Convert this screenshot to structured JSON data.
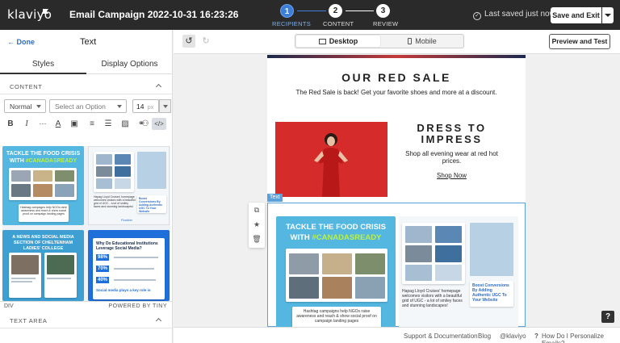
{
  "topbar": {
    "logo": "klaviyo",
    "campaign_title": "Email Campaign 2022-10-31 16:23:26",
    "steps": [
      {
        "num": "1",
        "label": "RECIPIENTS"
      },
      {
        "num": "2",
        "label": "CONTENT"
      },
      {
        "num": "3",
        "label": "REVIEW"
      }
    ],
    "saved_status": "Last saved just now",
    "save_exit_label": "Save and Exit"
  },
  "left_panel": {
    "done_label": "Done",
    "title": "Text",
    "tabs": [
      "Styles",
      "Display Options"
    ],
    "content_section": "CONTENT",
    "text_style": "Normal",
    "font_placeholder": "Select an Option",
    "font_size": "14",
    "font_unit": "px",
    "path_label": "DIV",
    "powered_by": "POWERED BY TINY",
    "text_area_section": "TEXT AREA"
  },
  "thumbnails": {
    "food_crisis_line1": "TACKLE THE FOOD CRISIS",
    "food_crisis_line2": "WITH",
    "food_crisis_tag": "#CANADASREADY",
    "news_title": "A NEWS AND SOCIAL MEDIA SECTION OF CHELTENHAM LADIES' COLLEGE",
    "edu_title": "Why Do Educational Institutions Leverage Social Media?",
    "stats": [
      "98%",
      "70%",
      "40%"
    ],
    "social_note": "Social media plays a key role in",
    "hashtag_note": "Hashtag campaigns help NGOs raise awareness and reach & show social proof on campaign landing pages",
    "boost_note": "Boost Conversions By Adding Authentic UGC To Your Website",
    "flockler": "Flockler",
    "hapag_note": "Hapag Lloyd Cruises' homepage welcomes visitors with a beautiful grid of UGC - a lot of smiley faces and stunning landscapes!"
  },
  "canvas": {
    "undo_icon": "undo-icon",
    "redo_icon": "redo-icon",
    "desktop_label": "Desktop",
    "mobile_label": "Mobile",
    "preview_label": "Preview and Test",
    "email": {
      "sale_title": "OUR RED SALE",
      "sale_sub": "The Red Sale is back! Get your favorite shoes and more at a discount.",
      "dress_title": "DRESS TO IMPRESS",
      "dress_sub": "Shop all evening wear at red hot prices.",
      "shop_now": "Shop Now"
    },
    "block_tag": "Text",
    "help_label": "?"
  },
  "footer": {
    "links": [
      "Support & Documentation",
      "Blog",
      "@klaviyo",
      "How Do I Personalize Emails?"
    ],
    "help_prefix": "?"
  },
  "colors": {
    "topbar_bg": "#2a2a2a",
    "accent_blue": "#3b7fd8",
    "selection_blue": "#5aa0db",
    "sale_red": "#d62b2b",
    "card_blue": "#53b7e0",
    "tag_green": "#b9f04a"
  }
}
